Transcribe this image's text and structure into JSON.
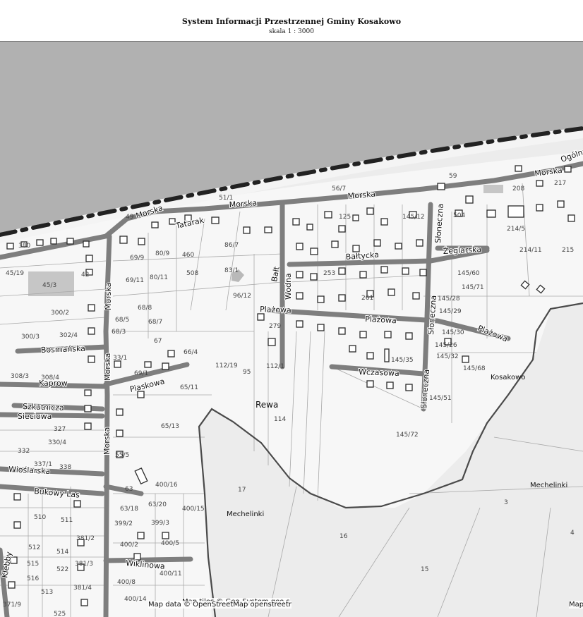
{
  "header": {
    "title": "System Informacji Przestrzennej Gminy Kosakowo",
    "scale": "skala 1 : 3000"
  },
  "map": {
    "places": [
      "Rewa",
      "Kosakowo",
      "Mechelinki",
      "Mechelinki"
    ],
    "streets": {
      "morska1": "Morska",
      "morska2": "Morska",
      "morska3": "Morska",
      "morska4": "Morska",
      "morska_v1": "Morska",
      "morska_v2": "Morska",
      "morska_v3": "Morska",
      "tatarak": "Tatarak",
      "baltycka": "Bałtycka",
      "balt": "Bałt",
      "wodna": "Wodna",
      "plazowa1": "Plażowa",
      "plazowa2": "Plażowa",
      "plazowa3": "Plażowa",
      "sloneczna1": "Słoneczna",
      "sloneczna2": "Słoneczna",
      "sloneczna3": "Słoneczna",
      "zeglarska": "Żeglarska",
      "wczasowa": "Wczasowa",
      "bosmanska": "Bosmańska",
      "piaskowa": "Piaskowa",
      "kaprow": "Kaprow",
      "szkutnicza": "Szkutnicza",
      "sieciowa": "Sieciowa",
      "wioslarska": "Wioślarska",
      "bukowy_las": "Bukowy Las",
      "wiklinowa": "Wiklinowa",
      "klebby": "Klebby",
      "ogolna": "Ogólna"
    },
    "parcels": [
      "59",
      "56/7",
      "51/1",
      "49",
      "125",
      "145/12",
      "504",
      "214/5",
      "214/11",
      "215",
      "208",
      "217",
      "69/9",
      "80/9",
      "460",
      "86/7",
      "83/1",
      "508",
      "69/11",
      "80/11",
      "45/3",
      "45/19",
      "380",
      "42",
      "253",
      "261",
      "145/60",
      "145/71",
      "145/28",
      "145/29",
      "145/30",
      "145/26",
      "145/32",
      "145/68",
      "145/35",
      "145/51",
      "145/72",
      "300/2",
      "302/4",
      "300/3",
      "308/3",
      "308/4",
      "327",
      "330/4",
      "332",
      "337/1",
      "338",
      "68/8",
      "68/5",
      "68/7",
      "68/3",
      "67",
      "66/4",
      "65/11",
      "65/13",
      "112/19",
      "95",
      "112/1",
      "114",
      "96/12",
      "279",
      "55/5",
      "63",
      "63/18",
      "63/20",
      "400/16",
      "400/15",
      "399/2",
      "399/3",
      "400/2",
      "400/5",
      "400/8",
      "400/11",
      "400/14",
      "510",
      "511",
      "512",
      "514",
      "515",
      "516",
      "522",
      "513",
      "525",
      "371/9",
      "381/2",
      "381/3",
      "381/4",
      "17",
      "16",
      "15",
      "3",
      "4",
      "33/1",
      "69/1"
    ],
    "attribution": {
      "tiles": "Map tiles © Geo-System geo.s",
      "data": "Map data © OpenStreetMap openstreetr",
      "right": "Map"
    }
  },
  "colors": {
    "sea": "#b1b1b1",
    "land": "#ececec",
    "road": "#7e7e7e",
    "boundary": "#4a4a4a",
    "building": "#2b2b2b"
  }
}
